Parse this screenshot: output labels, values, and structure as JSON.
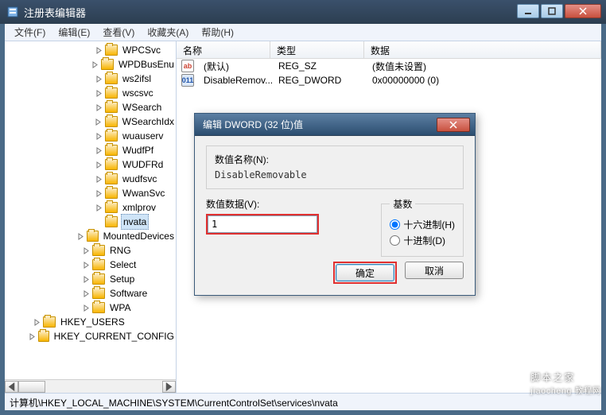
{
  "window": {
    "title": "注册表编辑器"
  },
  "menu": {
    "file": "文件(F)",
    "edit": "编辑(E)",
    "view": "查看(V)",
    "fav": "收藏夹(A)",
    "help": "帮助(H)"
  },
  "tree": {
    "items": [
      {
        "indent": "i3",
        "expander": true,
        "label": "WPCSvc"
      },
      {
        "indent": "i3",
        "expander": true,
        "label": "WPDBusEnu"
      },
      {
        "indent": "i3",
        "expander": true,
        "label": "ws2ifsl"
      },
      {
        "indent": "i3",
        "expander": true,
        "label": "wscsvc"
      },
      {
        "indent": "i3",
        "expander": true,
        "label": "WSearch"
      },
      {
        "indent": "i3",
        "expander": true,
        "label": "WSearchIdx"
      },
      {
        "indent": "i3",
        "expander": true,
        "label": "wuauserv"
      },
      {
        "indent": "i3",
        "expander": true,
        "label": "WudfPf"
      },
      {
        "indent": "i3",
        "expander": true,
        "label": "WUDFRd"
      },
      {
        "indent": "i3",
        "expander": true,
        "label": "wudfsvc"
      },
      {
        "indent": "i3",
        "expander": true,
        "label": "WwanSvc"
      },
      {
        "indent": "i3",
        "expander": true,
        "label": "xmlprov"
      },
      {
        "indent": "i3",
        "expander": false,
        "label": "nvata",
        "selected": true
      },
      {
        "indent": "i2",
        "expander": true,
        "label": "MountedDevices"
      },
      {
        "indent": "i2",
        "expander": true,
        "label": "RNG"
      },
      {
        "indent": "i2",
        "expander": true,
        "label": "Select"
      },
      {
        "indent": "i2",
        "expander": true,
        "label": "Setup"
      },
      {
        "indent": "i2",
        "expander": true,
        "label": "Software"
      },
      {
        "indent": "i2",
        "expander": true,
        "label": "WPA"
      },
      {
        "indent": "ia",
        "expander": true,
        "label": "HKEY_USERS"
      },
      {
        "indent": "ia",
        "expander": true,
        "label": "HKEY_CURRENT_CONFIG"
      }
    ]
  },
  "list": {
    "headers": {
      "name": "名称",
      "type": "类型",
      "data": "数据"
    },
    "rows": [
      {
        "icon": "sz",
        "name": "(默认)",
        "type": "REG_SZ",
        "data": "(数值未设置)"
      },
      {
        "icon": "dw",
        "name": "DisableRemov...",
        "type": "REG_DWORD",
        "data": "0x00000000 (0)"
      }
    ]
  },
  "statusbar": {
    "path": "计算机\\HKEY_LOCAL_MACHINE\\SYSTEM\\CurrentControlSet\\services\\nvata"
  },
  "dialog": {
    "title": "编辑 DWORD (32 位)值",
    "name_label": "数值名称(N):",
    "name_value": "DisableRemovable",
    "data_label": "数值数据(V):",
    "data_value": "1",
    "base_label": "基数",
    "radio_hex": "十六进制(H)",
    "radio_dec": "十进制(D)",
    "ok": "确定",
    "cancel": "取消"
  },
  "watermark": {
    "main": "脚本之家",
    "sub": "jiaocheng 教程网"
  }
}
